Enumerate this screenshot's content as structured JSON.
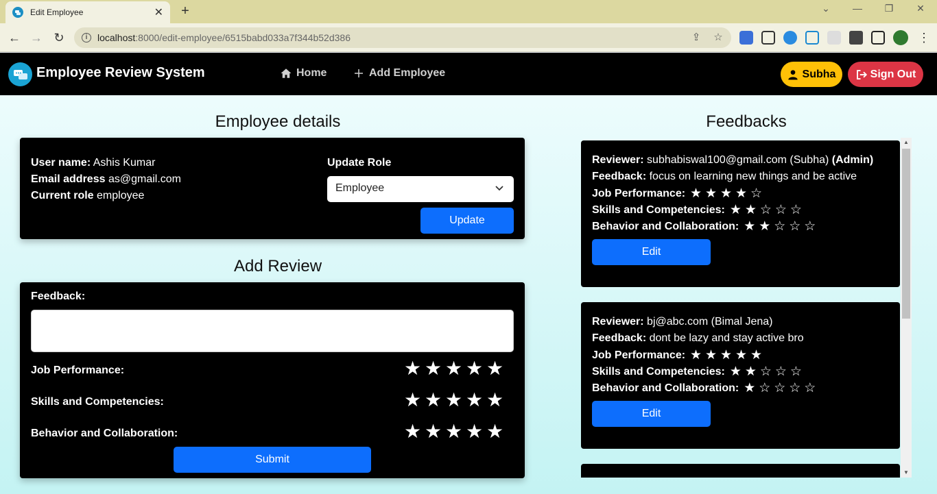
{
  "browser": {
    "tab_title": "Edit Employee",
    "url_host": "localhost",
    "url_path": ":8000/edit-employee/6515babd033a7f344b52d386"
  },
  "nav": {
    "brand": "Employee Review System",
    "home": "Home",
    "add_employee": "Add Employee",
    "user": "Subha",
    "sign_out": "Sign Out"
  },
  "employee": {
    "heading": "Employee details",
    "username_label": "User name:",
    "username": "Ashis Kumar",
    "email_label": "Email address",
    "email": "as@gmail.com",
    "role_label": "Current role",
    "role": "employee",
    "update_role_label": "Update Role",
    "role_selected": "Employee",
    "update_button": "Update"
  },
  "review": {
    "heading": "Add Review",
    "feedback_label": "Feedback:",
    "feedback_value": "",
    "job_label": "Job Performance:",
    "skills_label": "Skills and Competencies:",
    "behavior_label": "Behavior and Collaboration:",
    "submit": "Submit"
  },
  "feedbacks": {
    "heading": "Feedbacks",
    "labels": {
      "reviewer": "Reviewer:",
      "feedback": "Feedback:",
      "job": "Job Performance:",
      "skills": "Skills and Competencies:",
      "behavior": "Behavior and Collaboration:"
    },
    "items": [
      {
        "reviewer": "subhabiswal100@gmail.com (Subha)",
        "badge": "(Admin)",
        "feedback": "focus on learning new things and be active",
        "job_rating": 4,
        "skills_rating": 2,
        "behavior_rating": 2,
        "edit": "Edit"
      },
      {
        "reviewer": "bj@abc.com (Bimal Jena)",
        "badge": "",
        "feedback": "dont be lazy and stay active bro",
        "job_rating": 5,
        "skills_rating": 2,
        "behavior_rating": 1,
        "edit": "Edit"
      }
    ]
  }
}
